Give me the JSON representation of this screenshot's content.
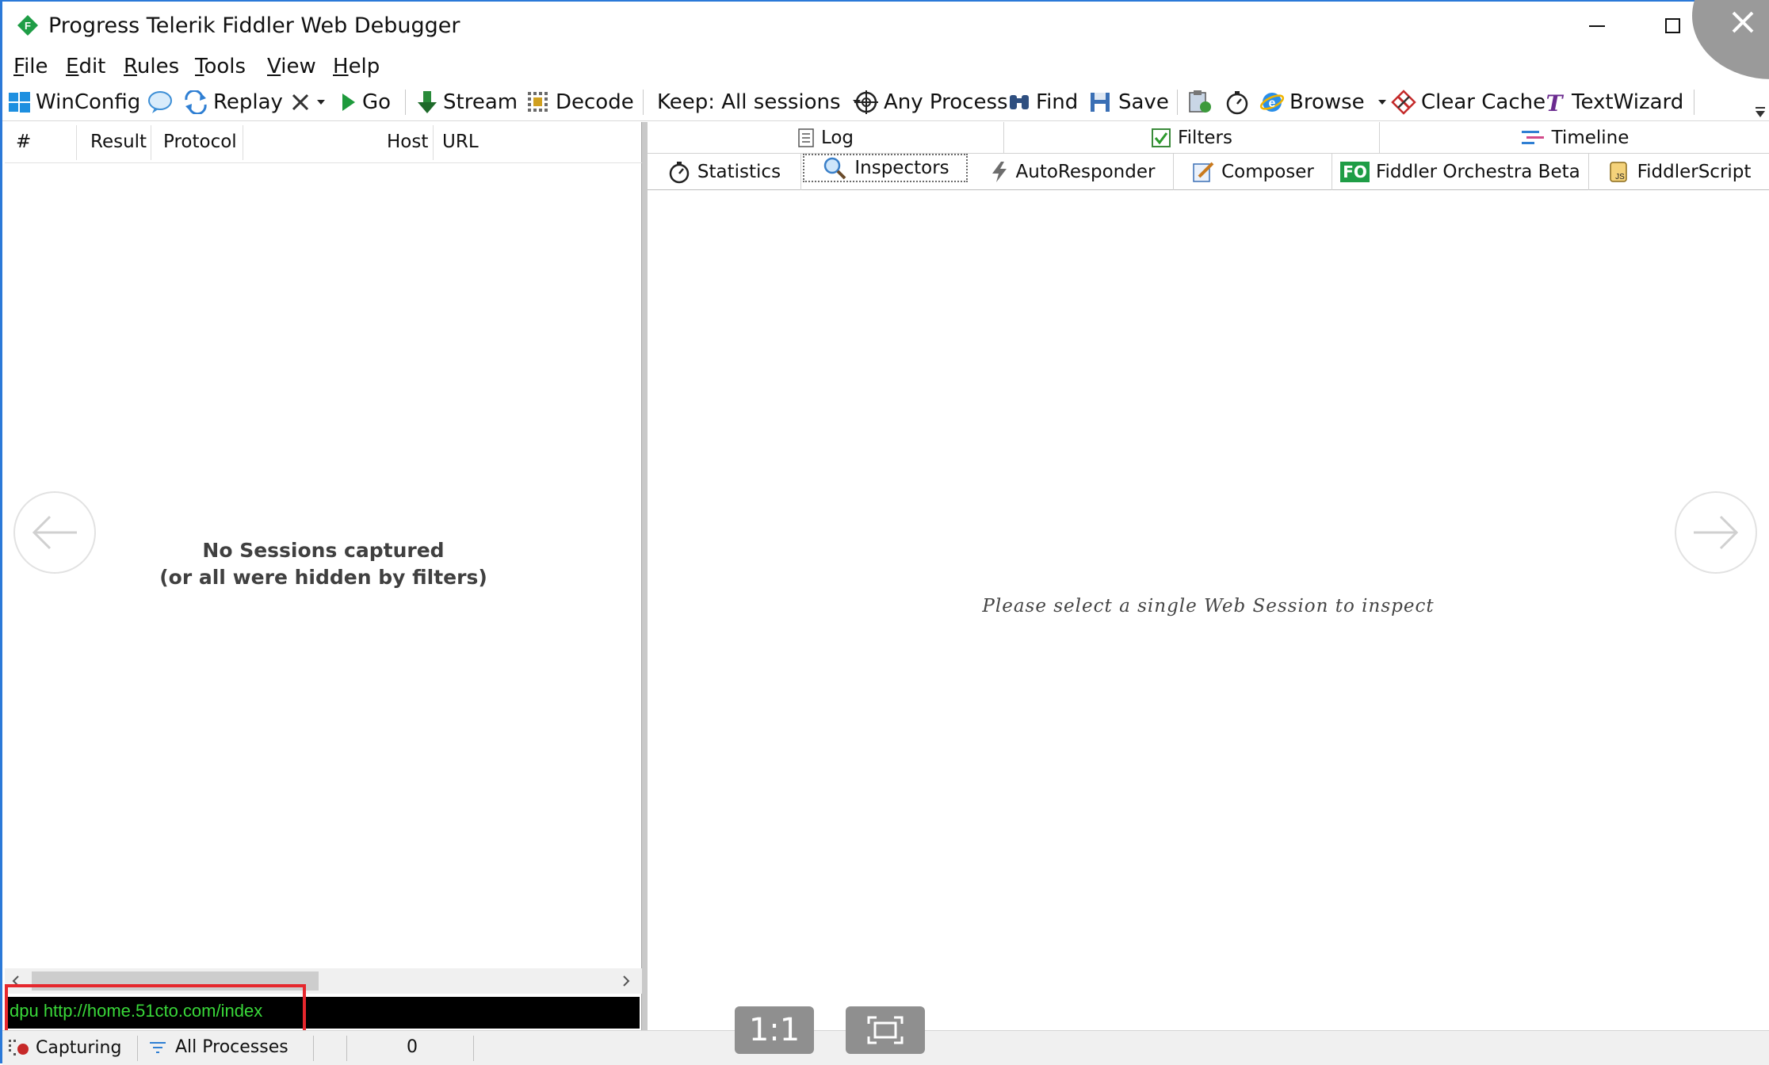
{
  "window": {
    "title": "Progress Telerik Fiddler Web Debugger"
  },
  "menu": {
    "file": {
      "mnemonic": "F",
      "rest": "ile"
    },
    "edit": {
      "mnemonic": "E",
      "rest": "dit"
    },
    "rules": {
      "mnemonic": "R",
      "rest": "ules"
    },
    "tools": {
      "mnemonic": "T",
      "rest": "ools"
    },
    "view": {
      "mnemonic": "V",
      "rest": "iew"
    },
    "help": {
      "mnemonic": "H",
      "rest": "elp"
    }
  },
  "toolbar": {
    "winconfig": "WinConfig",
    "replay": "Replay",
    "go": "Go",
    "stream": "Stream",
    "decode": "Decode",
    "keep": "Keep: All sessions",
    "any_process": "Any Process",
    "find": "Find",
    "save": "Save",
    "browse": "Browse",
    "clear_cache": "Clear Cache",
    "textwizard": "TextWizard"
  },
  "sessions": {
    "columns": {
      "num": "#",
      "result": "Result",
      "protocol": "Protocol",
      "host": "Host",
      "url": "URL"
    },
    "empty_line1": "No Sessions captured",
    "empty_line2": "(or all were hidden by filters)",
    "quickexec": "dpu http://home.51cto.com/index"
  },
  "tabs": {
    "log": "Log",
    "filters": "Filters",
    "timeline": "Timeline",
    "statistics": "Statistics",
    "inspectors": "Inspectors",
    "autoresponder": "AutoResponder",
    "composer": "Composer",
    "orchestra_badge": "FO",
    "orchestra": "Fiddler Orchestra Beta",
    "fiddlerscript": "FiddlerScript"
  },
  "inspector": {
    "message": "Please select a single Web Session to inspect"
  },
  "status": {
    "capturing": "Capturing",
    "processes": "All Processes",
    "count": "0"
  },
  "viewer": {
    "one_to_one": "1:1"
  },
  "colors": {
    "frame_blue": "#2b79d8",
    "highlight_red": "#e6272d",
    "quickexec_green": "#39d839"
  }
}
